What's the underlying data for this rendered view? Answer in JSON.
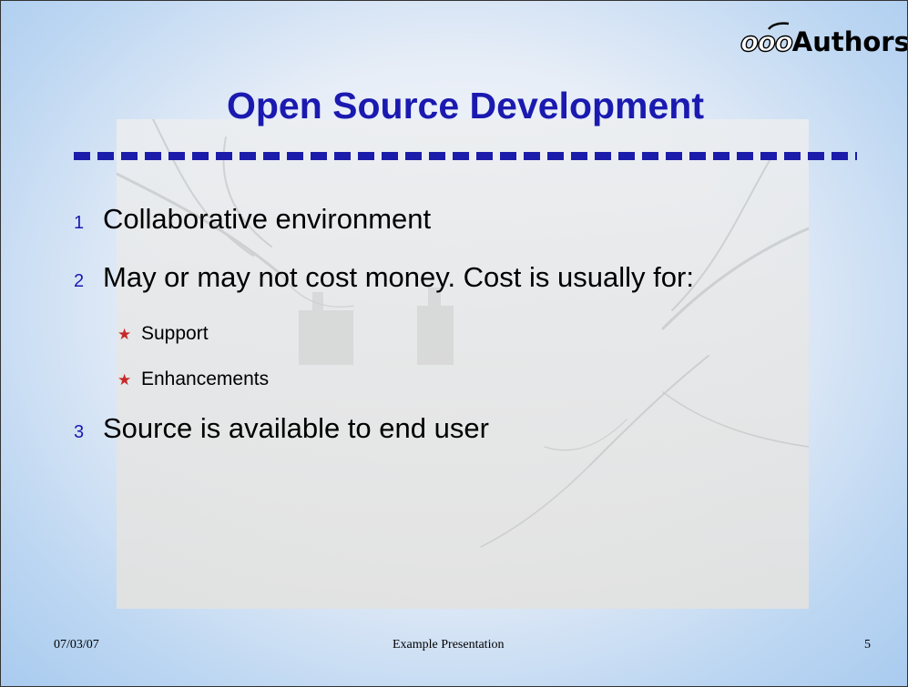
{
  "slide": {
    "logo": {
      "mark": "ooo",
      "word": "Authors"
    },
    "title": "Open Source Development",
    "bullets": [
      {
        "number": "1",
        "text": "Collaborative environment"
      },
      {
        "number": "2",
        "text": "May or may not cost money. Cost is usually for:",
        "sub": [
          {
            "marker": "★",
            "text": "Support"
          },
          {
            "marker": "★",
            "text": "Enhancements"
          }
        ]
      },
      {
        "number": "3",
        "text": "Source is available to end user"
      }
    ],
    "footer": {
      "date": "07/03/07",
      "center": "Example Presentation",
      "page": "5"
    },
    "colors": {
      "title": "#1a1ab0",
      "rule": "#1c1caa",
      "bullet_number": "#1a1ab0",
      "sub_marker": "#c62828",
      "background_edge": "#a9cbef"
    }
  }
}
